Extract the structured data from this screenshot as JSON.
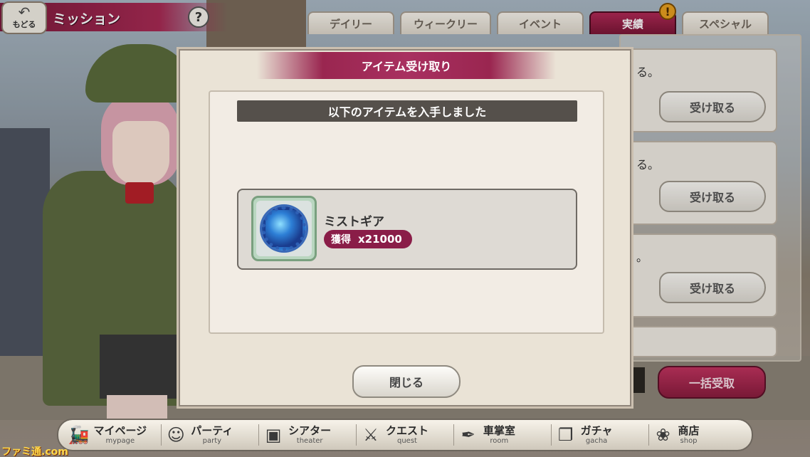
{
  "header": {
    "back_label": "もどる",
    "title": "ミッション",
    "help_label": "?"
  },
  "tabs": [
    {
      "label": "デイリー",
      "active": false
    },
    {
      "label": "ウィークリー",
      "active": false
    },
    {
      "label": "イベント",
      "active": false
    },
    {
      "label": "実績",
      "active": true
    },
    {
      "label": "スペシャル",
      "active": false
    }
  ],
  "tab_badge": "!",
  "mission_list": {
    "items": [
      {
        "text": "る。",
        "button": "受け取る"
      },
      {
        "text": "る。",
        "button": "受け取る"
      },
      {
        "text": "。",
        "button": "受け取る"
      }
    ],
    "bulk_button": "一括受取"
  },
  "modal": {
    "title": "アイテム受け取り",
    "subtitle": "以下のアイテムを入手しました",
    "item": {
      "name": "ミストギア",
      "qty_label": "獲得",
      "qty": "x21000",
      "icon": "blue-gear-icon"
    },
    "close_button": "閉じる"
  },
  "bottom_nav": [
    {
      "jp": "マイページ",
      "en": "mypage",
      "icon": "train-icon"
    },
    {
      "jp": "パーティ",
      "en": "party",
      "icon": "character-icon"
    },
    {
      "jp": "シアター",
      "en": "theater",
      "icon": "camera-icon"
    },
    {
      "jp": "クエスト",
      "en": "quest",
      "icon": "swords-icon"
    },
    {
      "jp": "車掌室",
      "en": "room",
      "icon": "quill-icon"
    },
    {
      "jp": "ガチャ",
      "en": "gacha",
      "icon": "ticket-icon"
    },
    {
      "jp": "商店",
      "en": "shop",
      "icon": "bear-icon"
    }
  ],
  "watermark": "ファミ通.com",
  "colors": {
    "accent": "#9a2650",
    "panel": "#eae3d6",
    "badge": "#e8a020"
  }
}
